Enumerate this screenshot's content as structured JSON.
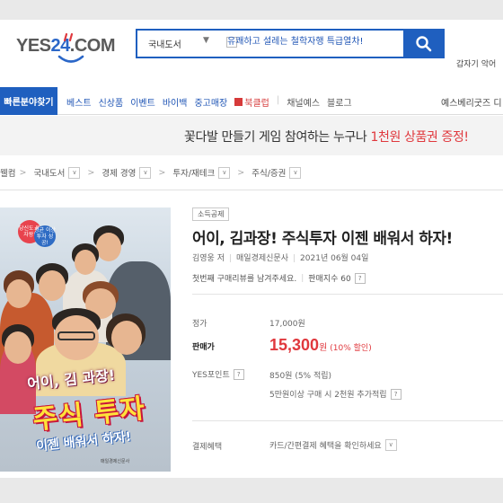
{
  "header": {
    "logo_text_left": "YES",
    "logo_text_num": "24",
    "logo_text_right": ".COM",
    "search_category": "국내도서",
    "search_query": "유쾌하고 설레는 철학자행 특급열차!",
    "search_icon": "search-icon",
    "right_text": "갑자기 악어"
  },
  "nav": {
    "quick_find": "빠른분야찾기",
    "items": [
      "베스트",
      "신상품",
      "이벤트",
      "바이백",
      "중고매장"
    ],
    "bookclub": "북클럽",
    "items2": [
      "채널예스",
      "블로그"
    ],
    "right": "예스베리굿즈  디"
  },
  "banner": {
    "text": "꽃다발 만들기 게임 참여하는 누구나 ",
    "highlight": "1천원 상품권 증정!"
  },
  "breadcrumb": [
    "웰컴",
    "국내도서",
    "경제 경영",
    "투자/재테크",
    "주식/증권"
  ],
  "cover": {
    "badge1": "당신도 투자왕!",
    "badge2": "평균 이상 투자 성공!",
    "title_line1": "어이, 김 과장!",
    "title_line2": "주식 투자",
    "title_line3": "이젠 배워서 하자!",
    "publisher": "매일경제신문사"
  },
  "product": {
    "tag": "소득공제",
    "title": "어이, 김과장! 주식투자 이젠 배워서 하자!",
    "author": "김영웅 저",
    "publisher": "매일경제신문사",
    "date": "2021년 06월 04일",
    "review_prompt": "첫번째 구매리뷰를 남겨주세요.",
    "sales_index": "판매지수 60",
    "list_price_label": "정가",
    "list_price": "17,000원",
    "sale_price_label": "판매가",
    "sale_price": "15,300",
    "sale_price_unit": "원",
    "discount": "(10% 할인)",
    "points_label": "YES포인트",
    "points_value": "850원 (5% 적립)",
    "points_extra": "5만원이상 구매 시 2천원 추가적립",
    "benefit_label": "결제혜택",
    "benefit_value": "카드/간편결제 혜택을 확인하세요"
  }
}
